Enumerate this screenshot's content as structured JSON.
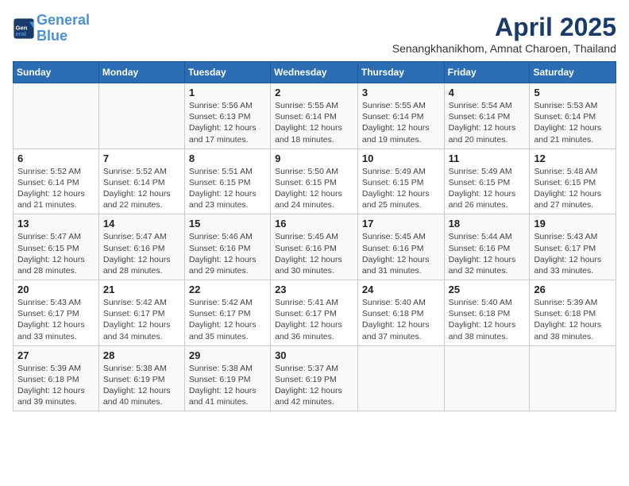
{
  "header": {
    "logo_line1": "General",
    "logo_line2": "Blue",
    "month_title": "April 2025",
    "subtitle": "Senangkhanikhom, Amnat Charoen, Thailand"
  },
  "days_of_week": [
    "Sunday",
    "Monday",
    "Tuesday",
    "Wednesday",
    "Thursday",
    "Friday",
    "Saturday"
  ],
  "weeks": [
    [
      {
        "day": "",
        "info": ""
      },
      {
        "day": "",
        "info": ""
      },
      {
        "day": "1",
        "info": "Sunrise: 5:56 AM\nSunset: 6:13 PM\nDaylight: 12 hours and 17 minutes."
      },
      {
        "day": "2",
        "info": "Sunrise: 5:55 AM\nSunset: 6:14 PM\nDaylight: 12 hours and 18 minutes."
      },
      {
        "day": "3",
        "info": "Sunrise: 5:55 AM\nSunset: 6:14 PM\nDaylight: 12 hours and 19 minutes."
      },
      {
        "day": "4",
        "info": "Sunrise: 5:54 AM\nSunset: 6:14 PM\nDaylight: 12 hours and 20 minutes."
      },
      {
        "day": "5",
        "info": "Sunrise: 5:53 AM\nSunset: 6:14 PM\nDaylight: 12 hours and 21 minutes."
      }
    ],
    [
      {
        "day": "6",
        "info": "Sunrise: 5:52 AM\nSunset: 6:14 PM\nDaylight: 12 hours and 21 minutes."
      },
      {
        "day": "7",
        "info": "Sunrise: 5:52 AM\nSunset: 6:14 PM\nDaylight: 12 hours and 22 minutes."
      },
      {
        "day": "8",
        "info": "Sunrise: 5:51 AM\nSunset: 6:15 PM\nDaylight: 12 hours and 23 minutes."
      },
      {
        "day": "9",
        "info": "Sunrise: 5:50 AM\nSunset: 6:15 PM\nDaylight: 12 hours and 24 minutes."
      },
      {
        "day": "10",
        "info": "Sunrise: 5:49 AM\nSunset: 6:15 PM\nDaylight: 12 hours and 25 minutes."
      },
      {
        "day": "11",
        "info": "Sunrise: 5:49 AM\nSunset: 6:15 PM\nDaylight: 12 hours and 26 minutes."
      },
      {
        "day": "12",
        "info": "Sunrise: 5:48 AM\nSunset: 6:15 PM\nDaylight: 12 hours and 27 minutes."
      }
    ],
    [
      {
        "day": "13",
        "info": "Sunrise: 5:47 AM\nSunset: 6:15 PM\nDaylight: 12 hours and 28 minutes."
      },
      {
        "day": "14",
        "info": "Sunrise: 5:47 AM\nSunset: 6:16 PM\nDaylight: 12 hours and 28 minutes."
      },
      {
        "day": "15",
        "info": "Sunrise: 5:46 AM\nSunset: 6:16 PM\nDaylight: 12 hours and 29 minutes."
      },
      {
        "day": "16",
        "info": "Sunrise: 5:45 AM\nSunset: 6:16 PM\nDaylight: 12 hours and 30 minutes."
      },
      {
        "day": "17",
        "info": "Sunrise: 5:45 AM\nSunset: 6:16 PM\nDaylight: 12 hours and 31 minutes."
      },
      {
        "day": "18",
        "info": "Sunrise: 5:44 AM\nSunset: 6:16 PM\nDaylight: 12 hours and 32 minutes."
      },
      {
        "day": "19",
        "info": "Sunrise: 5:43 AM\nSunset: 6:17 PM\nDaylight: 12 hours and 33 minutes."
      }
    ],
    [
      {
        "day": "20",
        "info": "Sunrise: 5:43 AM\nSunset: 6:17 PM\nDaylight: 12 hours and 33 minutes."
      },
      {
        "day": "21",
        "info": "Sunrise: 5:42 AM\nSunset: 6:17 PM\nDaylight: 12 hours and 34 minutes."
      },
      {
        "day": "22",
        "info": "Sunrise: 5:42 AM\nSunset: 6:17 PM\nDaylight: 12 hours and 35 minutes."
      },
      {
        "day": "23",
        "info": "Sunrise: 5:41 AM\nSunset: 6:17 PM\nDaylight: 12 hours and 36 minutes."
      },
      {
        "day": "24",
        "info": "Sunrise: 5:40 AM\nSunset: 6:18 PM\nDaylight: 12 hours and 37 minutes."
      },
      {
        "day": "25",
        "info": "Sunrise: 5:40 AM\nSunset: 6:18 PM\nDaylight: 12 hours and 38 minutes."
      },
      {
        "day": "26",
        "info": "Sunrise: 5:39 AM\nSunset: 6:18 PM\nDaylight: 12 hours and 38 minutes."
      }
    ],
    [
      {
        "day": "27",
        "info": "Sunrise: 5:39 AM\nSunset: 6:18 PM\nDaylight: 12 hours and 39 minutes."
      },
      {
        "day": "28",
        "info": "Sunrise: 5:38 AM\nSunset: 6:19 PM\nDaylight: 12 hours and 40 minutes."
      },
      {
        "day": "29",
        "info": "Sunrise: 5:38 AM\nSunset: 6:19 PM\nDaylight: 12 hours and 41 minutes."
      },
      {
        "day": "30",
        "info": "Sunrise: 5:37 AM\nSunset: 6:19 PM\nDaylight: 12 hours and 42 minutes."
      },
      {
        "day": "",
        "info": ""
      },
      {
        "day": "",
        "info": ""
      },
      {
        "day": "",
        "info": ""
      }
    ]
  ]
}
